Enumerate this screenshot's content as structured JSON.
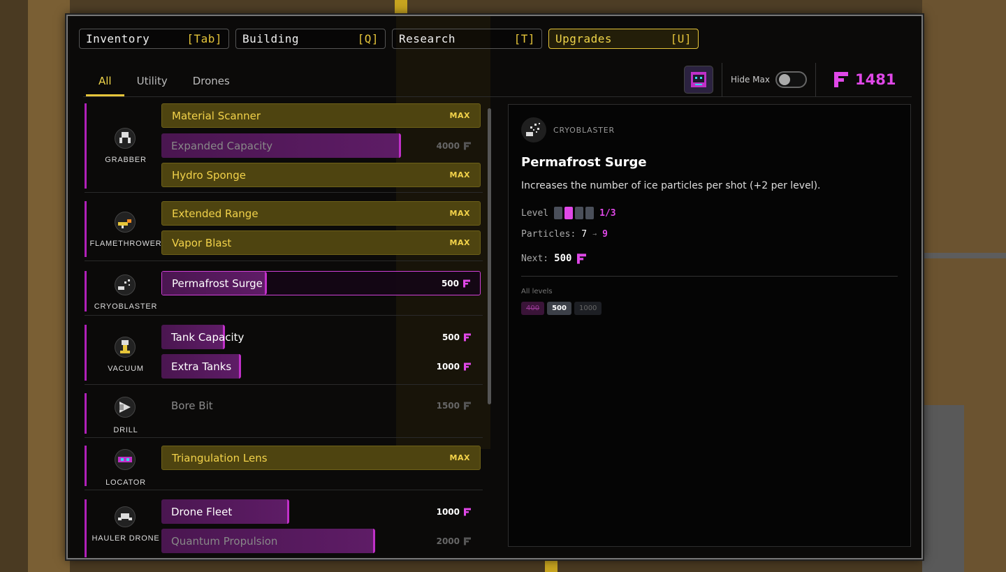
{
  "nav": [
    {
      "label": "Inventory",
      "key": "[Tab]",
      "active": false
    },
    {
      "label": "Building",
      "key": "[Q]",
      "active": false
    },
    {
      "label": "Research",
      "key": "[T]",
      "active": false
    },
    {
      "label": "Upgrades",
      "key": "[U]",
      "active": true
    }
  ],
  "subtabs": [
    {
      "label": "All",
      "active": true
    },
    {
      "label": "Utility",
      "active": false
    },
    {
      "label": "Drones",
      "active": false
    }
  ],
  "hide_max_label": "Hide Max",
  "currency_amount": "1481",
  "colors": {
    "accent_yellow": "#e6c53a",
    "accent_pink": "#e048e8"
  },
  "groups": [
    {
      "label": "GRABBER",
      "icon": "grabber-icon",
      "items": [
        {
          "name": "Material Scanner",
          "state": "max",
          "right": "MAX"
        },
        {
          "name": "Expanded Capacity",
          "state": "dim-progress",
          "right": "4000",
          "progress": 0.75
        },
        {
          "name": "Hydro Sponge",
          "state": "max",
          "right": "MAX"
        }
      ]
    },
    {
      "label": "FLAMETHROWER",
      "icon": "flamethrower-icon",
      "items": [
        {
          "name": "Extended Range",
          "state": "max",
          "right": "MAX"
        },
        {
          "name": "Vapor Blast",
          "state": "max",
          "right": "MAX"
        }
      ]
    },
    {
      "label": "CRYOBLASTER",
      "icon": "cryoblaster-icon",
      "items": [
        {
          "name": "Permafrost Surge",
          "state": "selected",
          "right": "500",
          "progress": 0.33
        }
      ]
    },
    {
      "label": "VACUUM",
      "icon": "vacuum-icon",
      "items": [
        {
          "name": "Tank Capacity",
          "state": "progress",
          "right": "500",
          "progress": 0.2
        },
        {
          "name": "Extra Tanks",
          "state": "progress",
          "right": "1000",
          "progress": 0.25
        }
      ]
    },
    {
      "label": "DRILL",
      "icon": "drill-icon",
      "items": [
        {
          "name": "Bore Bit",
          "state": "locked",
          "right": "1500"
        }
      ]
    },
    {
      "label": "LOCATOR",
      "icon": "locator-icon",
      "items": [
        {
          "name": "Triangulation Lens",
          "state": "max",
          "right": "MAX"
        }
      ]
    },
    {
      "label": "HAULER DRONE",
      "icon": "drone-icon",
      "items": [
        {
          "name": "Drone Fleet",
          "state": "progress",
          "right": "1000",
          "progress": 0.4
        },
        {
          "name": "Quantum Propulsion",
          "state": "dim-progress",
          "right": "2000",
          "progress": 0.67
        }
      ]
    }
  ],
  "detail": {
    "category": "CRYOBLASTER",
    "title": "Permafrost Surge",
    "description": "Increases the number of ice particles per shot (+2 per level).",
    "level_label": "Level",
    "level_text": "1/3",
    "level_filled": 1,
    "level_total": 3,
    "particles_label": "Particles:",
    "particles_from": "7",
    "particles_arrow": "→",
    "particles_to": "9",
    "next_label": "Next:",
    "next_cost": "500",
    "all_levels_label": "All levels",
    "levels": [
      {
        "cost": "400",
        "state": "done"
      },
      {
        "cost": "500",
        "state": "current"
      },
      {
        "cost": "1000",
        "state": "next"
      }
    ]
  }
}
